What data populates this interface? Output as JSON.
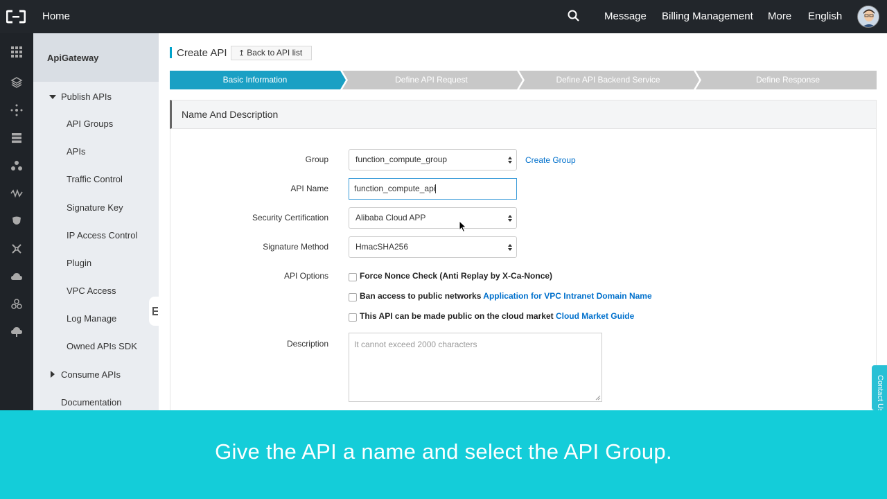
{
  "topbar": {
    "home": "Home",
    "nav": [
      "Message",
      "Billing Management",
      "More",
      "English"
    ]
  },
  "sidebar": {
    "title": "ApiGateway",
    "publish_apis": "Publish APIs",
    "items": [
      "API Groups",
      "APIs",
      "Traffic Control",
      "Signature Key",
      "IP Access Control",
      "Plugin",
      "VPC Access",
      "Log Manage",
      "Owned APIs SDK"
    ],
    "consume_apis": "Consume APIs",
    "documentation": "Documentation"
  },
  "page": {
    "title": "Create API",
    "back_label": "Back to API list"
  },
  "steps": [
    "Basic Information",
    "Define API Request",
    "Define API Backend Service",
    "Define Response"
  ],
  "section": {
    "title": "Name And Description"
  },
  "form": {
    "group_label": "Group",
    "group_value": "function_compute_group",
    "create_group": "Create Group",
    "api_name_label": "API Name",
    "api_name_value": "function_compute_api",
    "security_label": "Security Certification",
    "security_value": "Alibaba Cloud APP",
    "signature_label": "Signature Method",
    "signature_value": "HmacSHA256",
    "options_label": "API Options",
    "opt1": "Force Nonce Check (Anti Replay by X-Ca-Nonce)",
    "opt2": "Ban access to public networks",
    "opt2_link": "Application for VPC Intranet Domain Name",
    "opt3": "This API can be made public on the cloud market",
    "opt3_link": "Cloud Market Guide",
    "description_label": "Description",
    "description_placeholder": "It cannot exceed 2000 characters"
  },
  "contact_tab": "Contact Us",
  "caption": "Give the API a name and select the API Group.",
  "colors": {
    "accent": "#14a5c9",
    "caption_bg": "#14cdd9",
    "link": "#0070cc"
  }
}
